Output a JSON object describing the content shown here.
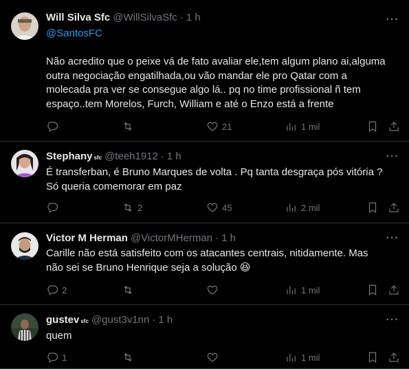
{
  "colors": {
    "background": "#000000",
    "text_primary": "#e7e9ea",
    "text_secondary": "#71767b",
    "link": "#1d9bf0",
    "divider": "#2f3336"
  },
  "tweets": [
    {
      "name": "Will Silva Sfc",
      "badge": "",
      "handle": "@WillSilvaSfc",
      "time": "1 h",
      "mention": "@SantosFC",
      "lines": [
        "Não acredito que o peixe vá de fato avaliar ele,tem algum plano ai,alguma",
        "outra negociação engatilhada,ou vão mandar ele pro Qatar com a",
        "molecada pra ver se consegue algo lá.. pq no time profissional ñ tem",
        "espaço..tem Morelos, Furch, William e até o Enzo está a frente"
      ],
      "replies": "",
      "retweets": "",
      "likes": "21",
      "views": "1 mil",
      "avatar_icon": "user-photo"
    },
    {
      "name": "Stephany",
      "badge": "sfc",
      "handle": "@teeh1912",
      "time": "1 h",
      "mention": "",
      "lines": [
        "É transferban, é Bruno Marques de volta . Pq tanta desgraça pós vitória ?",
        "Só queria comemorar em paz"
      ],
      "replies": "",
      "retweets": "2",
      "likes": "45",
      "views": "2 mil",
      "avatar_icon": "user-photo"
    },
    {
      "name": "Victor M Herman",
      "badge": "",
      "handle": "@VictorMHerman",
      "time": "1 h",
      "mention": "",
      "lines": [
        "Carille não está satisfeito com os atacantes centrais, nitidamente. Mas",
        "não sei se Bruno Henrique seja a solução 😆"
      ],
      "replies": "2",
      "retweets": "",
      "likes": "",
      "views": "1 mil",
      "avatar_icon": "user-photo"
    },
    {
      "name": "gustev",
      "badge": "sfc",
      "handle": "@gust3v1nn",
      "time": "1 h",
      "mention": "",
      "lines": [
        "quem"
      ],
      "replies": "1",
      "retweets": "",
      "likes": "",
      "views": "1 mil",
      "avatar_icon": "user-photo"
    }
  ],
  "icons": {
    "reply": "reply-icon",
    "retweet": "retweet-icon",
    "like": "heart-icon",
    "views": "views-icon",
    "bookmark": "bookmark-icon",
    "share": "share-icon",
    "more": "more-icon"
  }
}
